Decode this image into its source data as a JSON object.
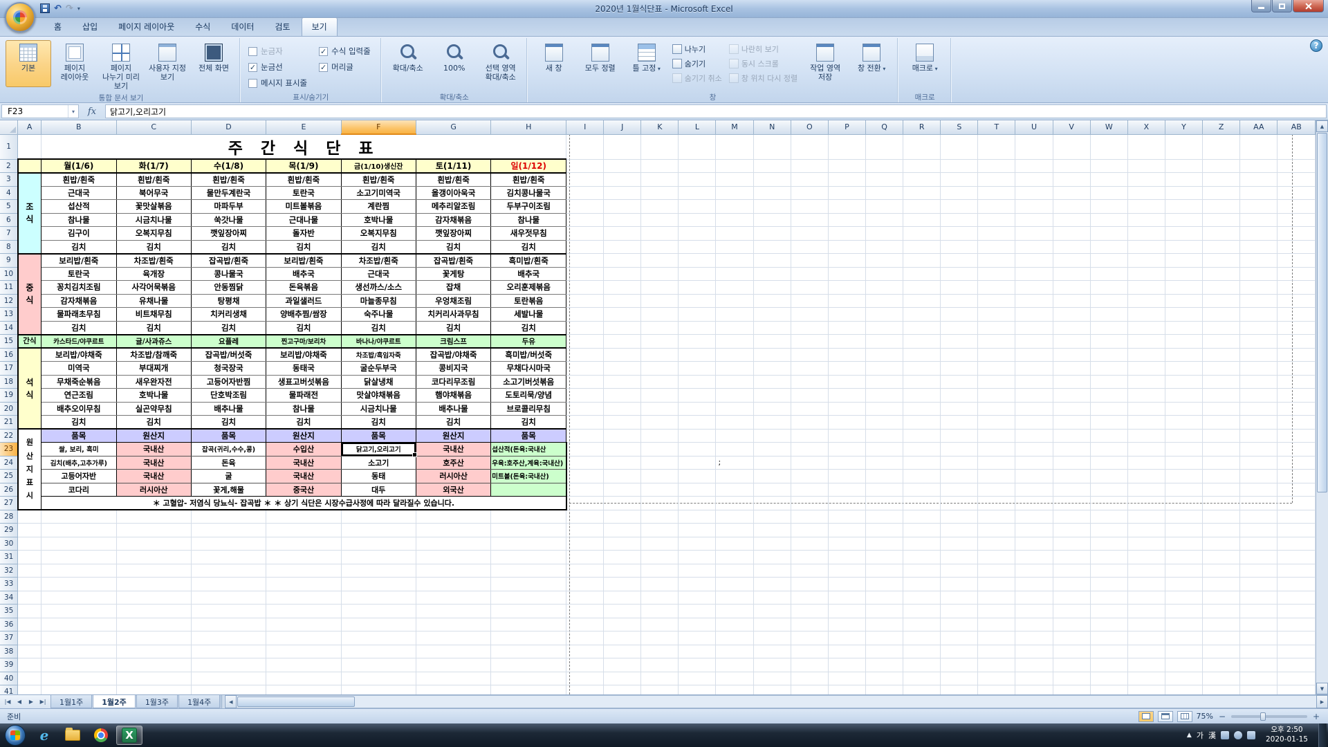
{
  "window": {
    "title": "2020년 1월식단표 - Microsoft Excel"
  },
  "ribbon": {
    "help_glyph": "?",
    "active_tab": "보기",
    "tabs": [
      {
        "name": "home",
        "label": "홈"
      },
      {
        "name": "insert",
        "label": "삽입"
      },
      {
        "name": "page-layout",
        "label": "페이지 레이아웃"
      },
      {
        "name": "formulas",
        "label": "수식"
      },
      {
        "name": "data",
        "label": "데이터"
      },
      {
        "name": "review",
        "label": "검토"
      },
      {
        "name": "view",
        "label": "보기"
      }
    ],
    "groups": [
      {
        "name": "workbook-views",
        "label": "통합 문서 보기",
        "type": "big",
        "items": [
          {
            "name": "normal-view",
            "icon": "normal-view",
            "label": "기본",
            "selected": true
          },
          {
            "name": "page-layout-view",
            "icon": "page-layout",
            "label": "페이지 레이아웃"
          },
          {
            "name": "page-break-preview",
            "icon": "page-break-preview",
            "label": "페이지 나누기 미리 보기"
          },
          {
            "name": "custom-views",
            "icon": "custom-views",
            "label": "사용자 지정 보기"
          },
          {
            "name": "full-screen",
            "icon": "full-screen",
            "label": "전체 화면"
          }
        ]
      },
      {
        "name": "show-hide",
        "label": "표시/숨기기",
        "type": "checks",
        "items": [
          {
            "name": "ruler",
            "label": "눈금자",
            "checked": false,
            "disabled": true
          },
          {
            "name": "gridlines",
            "label": "눈금선",
            "checked": true
          },
          {
            "name": "message-bar",
            "label": "메시지 표시줄",
            "checked": false
          },
          {
            "name": "formula-bar",
            "label": "수식 입력줄",
            "checked": true
          },
          {
            "name": "headings",
            "label": "머리글",
            "checked": true
          }
        ]
      },
      {
        "name": "zoom",
        "label": "확대/축소",
        "type": "big",
        "items": [
          {
            "name": "zoom",
            "icon": "zoom",
            "label": "확대/축소"
          },
          {
            "name": "zoom-100",
            "icon": "zoom",
            "label": "100%"
          },
          {
            "name": "zoom-selection",
            "icon": "zoom",
            "label": "선택 영역 확대/축소"
          }
        ]
      },
      {
        "name": "window",
        "label": "창",
        "type": "window",
        "big1": [
          {
            "name": "new-window",
            "icon": "window",
            "label": "새 창"
          },
          {
            "name": "arrange-all",
            "icon": "window",
            "label": "모두 정렬"
          },
          {
            "name": "freeze-panes",
            "icon": "freeze",
            "label": "틀 고정",
            "dropdown": true
          }
        ],
        "small1": [
          {
            "name": "split",
            "label": "나누기"
          },
          {
            "name": "hide",
            "label": "숨기기"
          },
          {
            "name": "unhide",
            "label": "숨기기 취소",
            "disabled": true
          }
        ],
        "small2": [
          {
            "name": "view-side-by-side",
            "label": "나란히 보기",
            "disabled": true
          },
          {
            "name": "synchronous-scrolling",
            "label": "동시 스크롤",
            "disabled": true
          },
          {
            "name": "reset-window-position",
            "label": "창 위치 다시 정렬",
            "disabled": true
          }
        ],
        "big2": [
          {
            "name": "save-workspace",
            "icon": "window",
            "label": "작업 영역 저장"
          },
          {
            "name": "switch-windows",
            "icon": "window",
            "label": "창 전환",
            "dropdown": true
          }
        ]
      },
      {
        "name": "macros",
        "label": "매크로",
        "type": "big",
        "items": [
          {
            "name": "macros",
            "icon": "macro",
            "label": "매크로",
            "dropdown": true
          }
        ]
      }
    ]
  },
  "formula_bar": {
    "name_box": "F23",
    "fx_label": "fx",
    "value": "닭고기,오리고기"
  },
  "sheet": {
    "col_headers": [
      "A",
      "B",
      "C",
      "D",
      "E",
      "F",
      "G",
      "H",
      "I",
      "J",
      "K",
      "L",
      "M",
      "N",
      "O",
      "P",
      "Q",
      "R",
      "S",
      "T",
      "U",
      "V",
      "W",
      "X",
      "Y",
      "Z",
      "AA",
      "AB"
    ],
    "selection": {
      "column": "F",
      "row": 23,
      "cell": "F23"
    },
    "stray": {
      "row": 24,
      "column": "M",
      "text": ";"
    },
    "title": "주 간 식 단 표",
    "header_bg": "#ffffcc",
    "day_headers": [
      {
        "text": "월(1/6)"
      },
      {
        "text": "화(1/7)"
      },
      {
        "text": "수(1/8)"
      },
      {
        "text": "목(1/9)"
      },
      {
        "text": "금(1/10)생신잔"
      },
      {
        "text": "토(1/11)"
      },
      {
        "text": "일(1/12)",
        "color": "#dd0000"
      }
    ],
    "sections": [
      {
        "name": "breakfast",
        "label": "조식",
        "label_bg": "#ccffff",
        "rows": [
          [
            "흰밥/흰죽",
            "흰밥/흰죽",
            "흰밥/흰죽",
            "흰밥/흰죽",
            "흰밥/흰죽",
            "흰밥/흰죽",
            "흰밥/흰죽"
          ],
          [
            "근대국",
            "북어무국",
            "물만두계란국",
            "토란국",
            "소고기미역국",
            "올갱이아욱국",
            "김치콩나물국"
          ],
          [
            "섭산적",
            "꽃맛살볶음",
            "마파두부",
            "미트볼볶음",
            "계란찜",
            "메추리알조림",
            "두부구이조림"
          ],
          [
            "참나물",
            "시금치나물",
            "쑥갓나물",
            "근대나물",
            "호박나물",
            "감자채볶음",
            "참나물"
          ],
          [
            "김구이",
            "오복지무침",
            "깻잎장아찌",
            "돌자반",
            "오복지무침",
            "깻잎장아찌",
            "새우젓무침"
          ],
          [
            "김치",
            "김치",
            "김치",
            "김치",
            "김치",
            "김치",
            "김치"
          ]
        ]
      },
      {
        "name": "lunch",
        "label": "중식",
        "label_bg": "#ffcccc",
        "rows": [
          [
            "보리밥/흰죽",
            "차조밥/흰죽",
            "잡곡밥/흰죽",
            "보리밥/흰죽",
            "차조밥/흰죽",
            "잡곡밥/흰죽",
            "흑미밥/흰죽"
          ],
          [
            "토란국",
            "육개장",
            "콩나물국",
            "배추국",
            "근대국",
            "꽃게탕",
            "배추국"
          ],
          [
            "꽁치김치조림",
            "사각어묵볶음",
            "안동찜닭",
            "돈육볶음",
            "생선까스/소스",
            "잡채",
            "오리훈제볶음"
          ],
          [
            "감자채볶음",
            "유채나물",
            "탕평채",
            "과일샐러드",
            "마늘종무침",
            "우엉채조림",
            "토란볶음"
          ],
          [
            "물파래초무침",
            "비트채무침",
            "치커리생채",
            "양배추찜/쌈장",
            "숙주나물",
            "치커리사과무침",
            "세발나물"
          ],
          [
            "김치",
            "김치",
            "김치",
            "김치",
            "김치",
            "김치",
            "김치"
          ]
        ]
      },
      {
        "name": "snack",
        "label": "간식",
        "label_bg": "#ccffcc",
        "single_row": [
          "카스타드/야쿠르트",
          "귤/사과쥬스",
          "요플레",
          "찐고구마/보리차",
          "바나나/야쿠르트",
          "크림스프",
          "두유"
        ]
      },
      {
        "name": "dinner",
        "label": "석식",
        "label_bg": "#ffffcc",
        "rows": [
          [
            "보리밥/야채죽",
            "차조밥/참깨죽",
            "잡곡밥/버섯죽",
            "보리밥/야채죽",
            "차조밥/흑임자죽",
            "잡곡밥/야채죽",
            "흑미밥/버섯죽"
          ],
          [
            "미역국",
            "부대찌개",
            "청국장국",
            "동태국",
            "굴순두부국",
            "콩비지국",
            "무채다시마국"
          ],
          [
            "무채죽순볶음",
            "새우완자전",
            "고등어자반찜",
            "생표고버섯볶음",
            "닭살냉채",
            "코다리무조림",
            "소고기버섯볶음"
          ],
          [
            "연근조림",
            "호박나물",
            "단호박조림",
            "물파래전",
            "맛살야채볶음",
            "햄야채볶음",
            "도토리묵/양념"
          ],
          [
            "배추오이무침",
            "실곤약무침",
            "배추나물",
            "참나물",
            "시금치나물",
            "배추나물",
            "브로콜리무침"
          ],
          [
            "김치",
            "김치",
            "김치",
            "김치",
            "김치",
            "김치",
            "김치"
          ]
        ]
      }
    ],
    "origin": {
      "label_chars": [
        "원",
        "산",
        "지",
        "표",
        "시"
      ],
      "header_bg": "#ccccff",
      "value_bg": "#ffcccc",
      "note_bg": "#ccffcc",
      "header": [
        "품목",
        "원산지",
        "품목",
        "원산지",
        "품목",
        "원산지",
        "품목"
      ],
      "rows": [
        [
          "쌀, 보리, 흑미",
          "국내산",
          "잡곡(귀리,수수,콩)",
          "수입산",
          "닭고기,오리고기",
          "국내산",
          "섭산적(돈육:국내산"
        ],
        [
          "김치(배추,고추가루)",
          "국내산",
          "돈육",
          "국내산",
          "소고기",
          "호주산",
          "우육:호주산,계육:국내산)"
        ],
        [
          "고등어자반",
          "국내산",
          "굴",
          "국내산",
          "동태",
          "러시아산",
          "미트볼(돈육:국내산)"
        ],
        [
          "코다리",
          "러시아산",
          "꽃게,해물",
          "중국산",
          "대두",
          "외국산",
          ""
        ]
      ]
    },
    "footer_note": "＊ 고혈압- 저염식   당뇨식- 잡곡밥 ＊      ＊ 상기 식단은  시장수급사정에 따라 달라질수 있습니다."
  },
  "sheet_tabs": {
    "tabs": [
      "1월1주",
      "1월2주",
      "1월3주",
      "1월4주"
    ],
    "active": "1월2주"
  },
  "status_bar": {
    "mode": "준비",
    "zoom": "75%",
    "zoom_out": "−",
    "zoom_in": "+"
  },
  "taskbar": {
    "ime_ko": "가",
    "ime_hanja": "漢",
    "ie_glyph": "e",
    "excel_glyph": "X",
    "clock_time": "오후 2:50",
    "clock_date": "2020-01-15"
  }
}
